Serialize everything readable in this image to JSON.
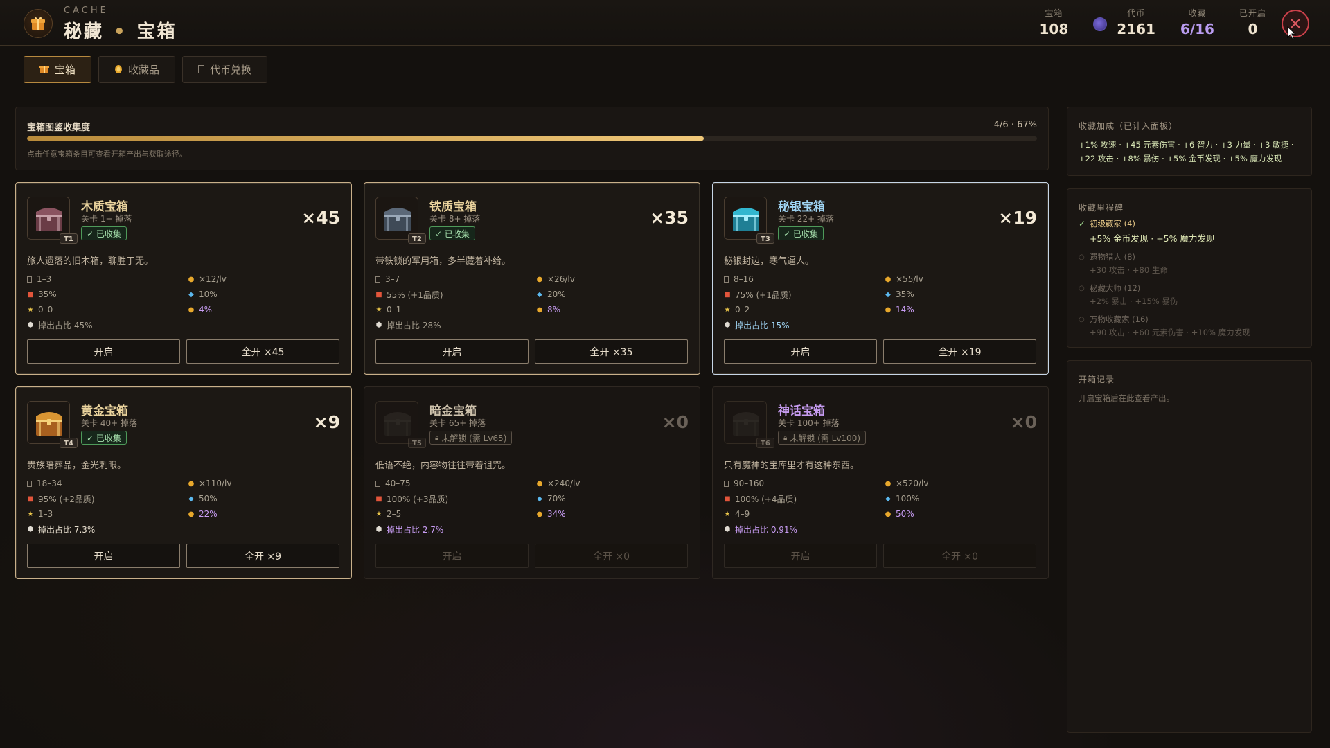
{
  "header": {
    "small_title": "CACHE",
    "title_left": "秘藏",
    "title_sep": "•",
    "title_right": "宝箱",
    "stats": [
      {
        "label": "宝箱",
        "value": "108"
      },
      {
        "label": "代币",
        "value": "2161"
      },
      {
        "label": "收藏",
        "value": "6/16"
      },
      {
        "label": "已开启",
        "value": "0"
      }
    ]
  },
  "tabs": [
    {
      "label": "宝箱",
      "icon": "gift-icon",
      "active": true
    },
    {
      "label": "收藏品",
      "icon": "coin-icon",
      "active": false
    },
    {
      "label": "代币兑换",
      "icon": "token-icon",
      "active": false
    }
  ],
  "progress": {
    "title": "宝箱图鉴收集度",
    "value_text": "4/6 · 67%",
    "fraction": 0.67,
    "hint": "点击任意宝箱条目可查看开箱产出与获取途径。"
  },
  "chests": [
    {
      "name": "木质宝箱",
      "tier": "T1",
      "stage": "关卡 1+ 掉落",
      "badge": "✓ 已收集",
      "count": "×45",
      "desc": "旅人遗落的旧木箱，聊胜于无。",
      "range": "1–3",
      "rate": "35%",
      "stars": "0–0",
      "share": "掉出占比 45%",
      "coin": "×12/lv",
      "gem": "10%",
      "orb": "4%",
      "open": "开启",
      "open_all": "全开 ×45",
      "colors": {
        "body": "#6a3c46",
        "lid": "#8a5360",
        "band": "#c7a0a8"
      }
    },
    {
      "name": "铁质宝箱",
      "tier": "T2",
      "stage": "关卡 8+ 掉落",
      "badge": "✓ 已收集",
      "count": "×35",
      "desc": "带铁锁的军用箱，多半藏着补给。",
      "range": "3–7",
      "rate": "55% (+1品质)",
      "stars": "0–1",
      "share": "掉出占比 28%",
      "coin": "×26/lv",
      "gem": "20%",
      "orb": "8%",
      "open": "开启",
      "open_all": "全开 ×35",
      "colors": {
        "body": "#3f4a57",
        "lid": "#5b6878",
        "band": "#9aa8b8"
      }
    },
    {
      "name": "秘银宝箱",
      "tier": "T3",
      "stage": "关卡 22+ 掉落",
      "badge": "✓ 已收集",
      "count": "×19",
      "desc": "秘银封边，寒气逼人。",
      "range": "8–16",
      "rate": "75% (+1品质)",
      "stars": "0–2",
      "share": "掉出占比 15%",
      "coin": "×55/lv",
      "gem": "35%",
      "orb": "14%",
      "open": "开启",
      "open_all": "全开 ×19",
      "colors": {
        "body": "#1f7f95",
        "lid": "#32b6cf",
        "band": "#a6eefc"
      }
    },
    {
      "name": "黄金宝箱",
      "tier": "T4",
      "stage": "关卡 40+ 掉落",
      "badge": "✓ 已收集",
      "count": "×9",
      "desc": "贵族陪葬品，金光刺眼。",
      "range": "18–34",
      "rate": "95% (+2品质)",
      "stars": "1–3",
      "share": "掉出占比 7.3%",
      "coin": "×110/lv",
      "gem": "50%",
      "orb": "22%",
      "open": "开启",
      "open_all": "全开 ×9",
      "colors": {
        "body": "#a8601f",
        "lid": "#d99533",
        "band": "#f6d27a"
      }
    },
    {
      "name": "暗金宝箱",
      "tier": "T5",
      "stage": "关卡 65+ 掉落",
      "badge": "未解锁 (需 Lv65)",
      "count": "×0",
      "desc": "低语不绝，内容物往往带着诅咒。",
      "range": "40–75",
      "rate": "100% (+3品质)",
      "stars": "2–5",
      "share": "掉出占比 2.7%",
      "coin": "×240/lv",
      "gem": "70%",
      "orb": "34%",
      "open": "开启",
      "open_all": "全开 ×0",
      "colors": {
        "body": "#2a2622",
        "lid": "#332e29",
        "band": "#3d3832"
      }
    },
    {
      "name": "神话宝箱",
      "tier": "T6",
      "stage": "关卡 100+ 掉落",
      "badge": "未解锁 (需 Lv100)",
      "count": "×0",
      "desc": "只有魔神的宝库里才有这种东西。",
      "range": "90–160",
      "rate": "100% (+4品质)",
      "stars": "4–9",
      "share": "掉出占比 0.91%",
      "coin": "×520/lv",
      "gem": "100%",
      "orb": "50%",
      "open": "开启",
      "open_all": "全开 ×0",
      "colors": {
        "body": "#2a2622",
        "lid": "#332e29",
        "band": "#3d3832"
      }
    }
  ],
  "bonus": {
    "title": "收藏加成（已计入面板）",
    "text": "+1% 攻速 · +45 元素伤害 · +6 智力 · +3 力量 · +3 敏捷 · +22 攻击 · +8% 暴伤 · +5% 金币发现 · +5% 魔力发现"
  },
  "milestones": {
    "title": "收藏里程碑",
    "items": [
      {
        "name": "初级藏家 (4)",
        "effect": "+5% 金币发现 · +5% 魔力发现",
        "done": true
      },
      {
        "name": "遗物猎人 (8)",
        "effect": "+30 攻击 · +80 生命",
        "done": false
      },
      {
        "name": "秘藏大师 (12)",
        "effect": "+2% 暴击 · +15% 暴伤",
        "done": false
      },
      {
        "name": "万物收藏家 (16)",
        "effect": "+90 攻击 · +60 元素伤害 · +10% 魔力发现",
        "done": false
      }
    ]
  },
  "log": {
    "title": "开箱记录",
    "hint": "开启宝箱后在此查看产出。"
  },
  "theme": {
    "accent": "#c9a35c",
    "collected_badge": "#4e9a5a",
    "close": "#c9404a"
  }
}
